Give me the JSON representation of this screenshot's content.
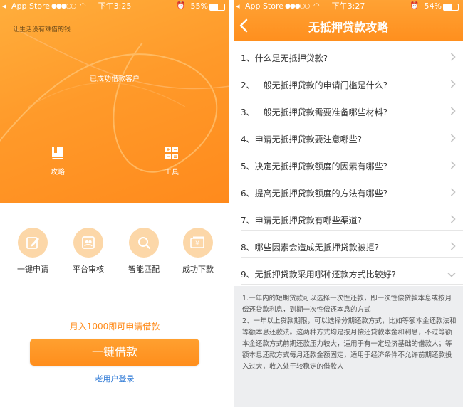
{
  "left": {
    "status": {
      "back": "◂",
      "carrier": "App Store",
      "time": "下午3:25",
      "battery": "55%",
      "battery_level": 0.55
    },
    "hero": {
      "slogan": "让生活没有难借的钱",
      "success_text": "已成功借款客户",
      "tools": [
        {
          "label": "攻略",
          "icon": "book-icon"
        },
        {
          "label": "工具",
          "icon": "calculator-icon"
        }
      ]
    },
    "features": [
      {
        "label": "一键申请",
        "icon": "edit-icon"
      },
      {
        "label": "平台审核",
        "icon": "review-icon"
      },
      {
        "label": "智能匹配",
        "icon": "search-icon"
      },
      {
        "label": "成功下款",
        "icon": "money-icon"
      }
    ],
    "promo": "月入1000即可申请借款",
    "cta": "一键借款",
    "login": "老用户登录"
  },
  "right": {
    "status": {
      "back": "◂",
      "carrier": "App Store",
      "time": "下午3:27",
      "battery": "54%",
      "battery_level": 0.54
    },
    "title": "无抵押贷款攻略",
    "faq": [
      "1、什么是无抵押贷款?",
      "2、一般无抵押贷款的申请门槛是什么?",
      "3、一般无抵押贷款需要准备哪些材料?",
      "4、申请无抵押贷款要注意哪些?",
      "5、决定无抵押贷款额度的因素有哪些?",
      "6、提高无抵押贷款额度的方法有哪些?",
      "7、申请无抵押贷款有哪些渠道?",
      "8、哪些因素会造成无抵押贷款被拒?",
      "9、无抵押贷款采用哪种还款方式比较好?"
    ],
    "answer": [
      "1.一年内的短期贷款可以选择一次性还款，即一次性偿贷款本息或按月偿还贷款利息，到期一次性偿还本息的方式",
      "2、一年以上贷款期限，可以选择分期还款方式，比如等额本金还款法和等额本息还款法。这两种方式均是按月偿还贷款本金和利息，不过等额本金还款方式前期还款压力较大，适用于有一定经济基础的借款人；等额本息还款方式每月还款金额固定，适用于经济条件不允许前期还款投入过大，收入处于较稳定的借款人"
    ]
  },
  "colors": {
    "accent": "#ff9a2a",
    "link": "#2f7ad6",
    "answer_bg": "#edeef0"
  }
}
